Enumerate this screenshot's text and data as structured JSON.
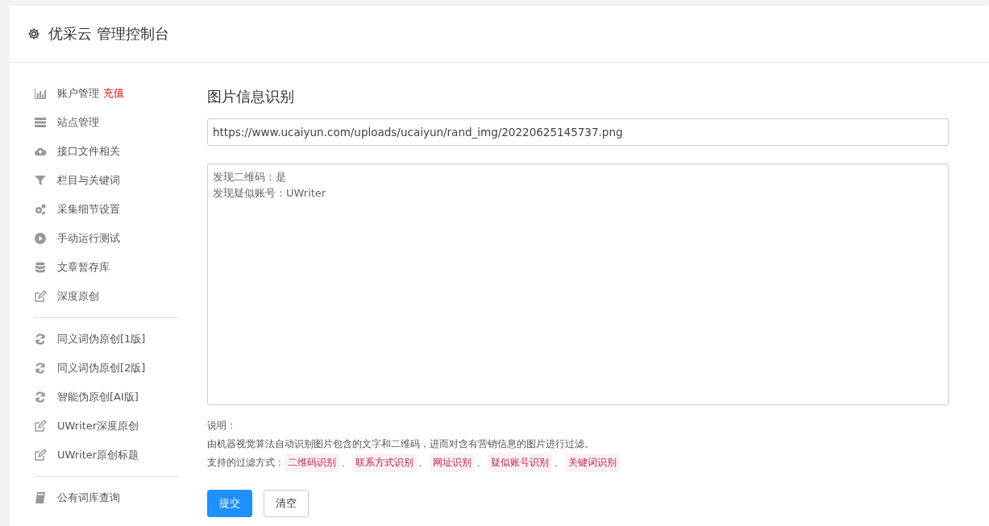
{
  "header": {
    "title": "优采云 管理控制台"
  },
  "sidebar": {
    "groups": [
      {
        "items": [
          {
            "kind": "chart",
            "label": "账户管理",
            "badge": "充值"
          },
          {
            "kind": "server",
            "label": "站点管理"
          },
          {
            "kind": "cloud",
            "label": "接口文件相关"
          },
          {
            "kind": "filter",
            "label": "栏目与关键词"
          },
          {
            "kind": "cogs",
            "label": "采集细节设置"
          },
          {
            "kind": "play",
            "label": "手动运行测试"
          },
          {
            "kind": "database",
            "label": "文章暂存库"
          },
          {
            "kind": "edit",
            "label": "深度原创"
          }
        ]
      },
      {
        "items": [
          {
            "kind": "refresh",
            "label": "同义词伪原创[1版]"
          },
          {
            "kind": "refresh",
            "label": "同义词伪原创[2版]"
          },
          {
            "kind": "refresh",
            "label": "智能伪原创[AI版]"
          },
          {
            "kind": "edit",
            "label": "UWriter深度原创"
          },
          {
            "kind": "edit",
            "label": "UWriter原创标题"
          }
        ]
      },
      {
        "items": [
          {
            "kind": "book",
            "label": "公有词库查询"
          }
        ]
      }
    ]
  },
  "main": {
    "title": "图片信息识别",
    "url_field": {
      "value": "https://www.ucaiyun.com/uploads/ucaiyun/rand_img/20220625145737.png"
    },
    "result_box": {
      "lines": [
        "发现二维码：是",
        "发现疑似账号：UWriter"
      ]
    },
    "notes": {
      "heading": "说明：",
      "description": "由机器视觉算法自动识别图片包含的文字和二维码，进而对含有营销信息的图片进行过滤。",
      "methods_label": "支持的过滤方式：",
      "separator": "、",
      "methods": [
        "二维码识别",
        "联系方式识别",
        "网址识别",
        "疑似账号识别",
        "关键词识别"
      ]
    },
    "buttons": [
      {
        "label": "提交",
        "kind": "primary"
      },
      {
        "label": "清空",
        "kind": "default"
      }
    ]
  }
}
